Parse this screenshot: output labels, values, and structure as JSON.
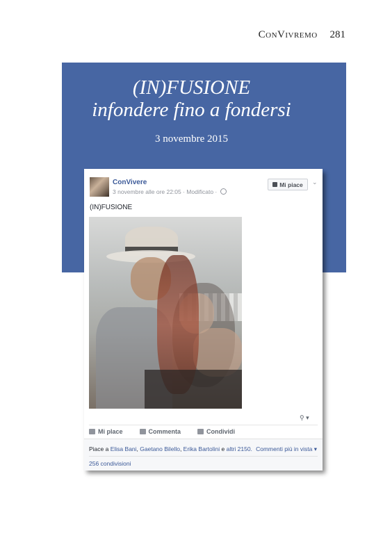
{
  "header": {
    "brand": "ConVivremo",
    "page_number": "281"
  },
  "banner": {
    "title": "(IN)FUSIONE",
    "subtitle": "infondere fino a fondersi",
    "date": "3 novembre 2015"
  },
  "post": {
    "page_name": "ConVivere",
    "meta": "3 novembre alle ore 22:05 · Modificato ·",
    "like_page_button": "Mi piace",
    "text": "(IN)FUSIONE",
    "actions": {
      "like": "Mi place",
      "comment": "Commenta",
      "share": "Condividi"
    },
    "likes": {
      "prefix": "Piace a",
      "names": [
        "Elisa Bani",
        "Gaetano Bilello",
        "Erika Bartolini"
      ],
      "conj": "e",
      "others": "altri 2150."
    },
    "comment_sort": "Commenti più in vista ▾",
    "shares": "256 condivisioni"
  },
  "colors": {
    "banner": "#4766a3",
    "link": "#3b5998"
  },
  "icons": [
    "thumbs-up-icon",
    "comment-icon",
    "share-icon",
    "globe-icon",
    "chevron-down-icon",
    "tag-icon"
  ]
}
